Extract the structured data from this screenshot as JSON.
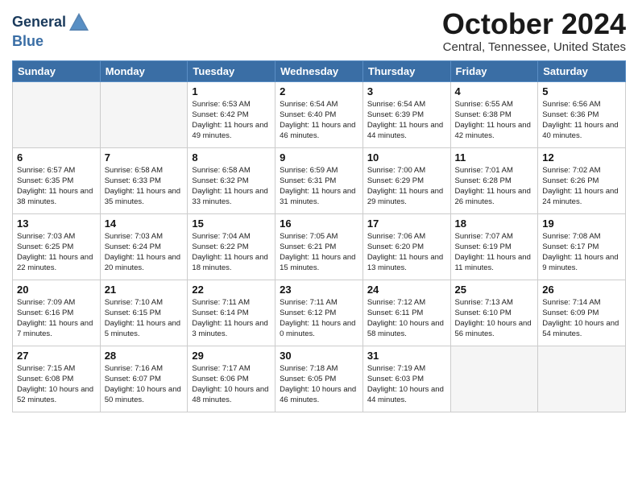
{
  "logo": {
    "line1": "General",
    "line2": "Blue"
  },
  "title": "October 2024",
  "subtitle": "Central, Tennessee, United States",
  "weekdays": [
    "Sunday",
    "Monday",
    "Tuesday",
    "Wednesday",
    "Thursday",
    "Friday",
    "Saturday"
  ],
  "weeks": [
    [
      {
        "day": "",
        "sunrise": "",
        "sunset": "",
        "daylight": ""
      },
      {
        "day": "",
        "sunrise": "",
        "sunset": "",
        "daylight": ""
      },
      {
        "day": "1",
        "sunrise": "Sunrise: 6:53 AM",
        "sunset": "Sunset: 6:42 PM",
        "daylight": "Daylight: 11 hours and 49 minutes."
      },
      {
        "day": "2",
        "sunrise": "Sunrise: 6:54 AM",
        "sunset": "Sunset: 6:40 PM",
        "daylight": "Daylight: 11 hours and 46 minutes."
      },
      {
        "day": "3",
        "sunrise": "Sunrise: 6:54 AM",
        "sunset": "Sunset: 6:39 PM",
        "daylight": "Daylight: 11 hours and 44 minutes."
      },
      {
        "day": "4",
        "sunrise": "Sunrise: 6:55 AM",
        "sunset": "Sunset: 6:38 PM",
        "daylight": "Daylight: 11 hours and 42 minutes."
      },
      {
        "day": "5",
        "sunrise": "Sunrise: 6:56 AM",
        "sunset": "Sunset: 6:36 PM",
        "daylight": "Daylight: 11 hours and 40 minutes."
      }
    ],
    [
      {
        "day": "6",
        "sunrise": "Sunrise: 6:57 AM",
        "sunset": "Sunset: 6:35 PM",
        "daylight": "Daylight: 11 hours and 38 minutes."
      },
      {
        "day": "7",
        "sunrise": "Sunrise: 6:58 AM",
        "sunset": "Sunset: 6:33 PM",
        "daylight": "Daylight: 11 hours and 35 minutes."
      },
      {
        "day": "8",
        "sunrise": "Sunrise: 6:58 AM",
        "sunset": "Sunset: 6:32 PM",
        "daylight": "Daylight: 11 hours and 33 minutes."
      },
      {
        "day": "9",
        "sunrise": "Sunrise: 6:59 AM",
        "sunset": "Sunset: 6:31 PM",
        "daylight": "Daylight: 11 hours and 31 minutes."
      },
      {
        "day": "10",
        "sunrise": "Sunrise: 7:00 AM",
        "sunset": "Sunset: 6:29 PM",
        "daylight": "Daylight: 11 hours and 29 minutes."
      },
      {
        "day": "11",
        "sunrise": "Sunrise: 7:01 AM",
        "sunset": "Sunset: 6:28 PM",
        "daylight": "Daylight: 11 hours and 26 minutes."
      },
      {
        "day": "12",
        "sunrise": "Sunrise: 7:02 AM",
        "sunset": "Sunset: 6:26 PM",
        "daylight": "Daylight: 11 hours and 24 minutes."
      }
    ],
    [
      {
        "day": "13",
        "sunrise": "Sunrise: 7:03 AM",
        "sunset": "Sunset: 6:25 PM",
        "daylight": "Daylight: 11 hours and 22 minutes."
      },
      {
        "day": "14",
        "sunrise": "Sunrise: 7:03 AM",
        "sunset": "Sunset: 6:24 PM",
        "daylight": "Daylight: 11 hours and 20 minutes."
      },
      {
        "day": "15",
        "sunrise": "Sunrise: 7:04 AM",
        "sunset": "Sunset: 6:22 PM",
        "daylight": "Daylight: 11 hours and 18 minutes."
      },
      {
        "day": "16",
        "sunrise": "Sunrise: 7:05 AM",
        "sunset": "Sunset: 6:21 PM",
        "daylight": "Daylight: 11 hours and 15 minutes."
      },
      {
        "day": "17",
        "sunrise": "Sunrise: 7:06 AM",
        "sunset": "Sunset: 6:20 PM",
        "daylight": "Daylight: 11 hours and 13 minutes."
      },
      {
        "day": "18",
        "sunrise": "Sunrise: 7:07 AM",
        "sunset": "Sunset: 6:19 PM",
        "daylight": "Daylight: 11 hours and 11 minutes."
      },
      {
        "day": "19",
        "sunrise": "Sunrise: 7:08 AM",
        "sunset": "Sunset: 6:17 PM",
        "daylight": "Daylight: 11 hours and 9 minutes."
      }
    ],
    [
      {
        "day": "20",
        "sunrise": "Sunrise: 7:09 AM",
        "sunset": "Sunset: 6:16 PM",
        "daylight": "Daylight: 11 hours and 7 minutes."
      },
      {
        "day": "21",
        "sunrise": "Sunrise: 7:10 AM",
        "sunset": "Sunset: 6:15 PM",
        "daylight": "Daylight: 11 hours and 5 minutes."
      },
      {
        "day": "22",
        "sunrise": "Sunrise: 7:11 AM",
        "sunset": "Sunset: 6:14 PM",
        "daylight": "Daylight: 11 hours and 3 minutes."
      },
      {
        "day": "23",
        "sunrise": "Sunrise: 7:11 AM",
        "sunset": "Sunset: 6:12 PM",
        "daylight": "Daylight: 11 hours and 0 minutes."
      },
      {
        "day": "24",
        "sunrise": "Sunrise: 7:12 AM",
        "sunset": "Sunset: 6:11 PM",
        "daylight": "Daylight: 10 hours and 58 minutes."
      },
      {
        "day": "25",
        "sunrise": "Sunrise: 7:13 AM",
        "sunset": "Sunset: 6:10 PM",
        "daylight": "Daylight: 10 hours and 56 minutes."
      },
      {
        "day": "26",
        "sunrise": "Sunrise: 7:14 AM",
        "sunset": "Sunset: 6:09 PM",
        "daylight": "Daylight: 10 hours and 54 minutes."
      }
    ],
    [
      {
        "day": "27",
        "sunrise": "Sunrise: 7:15 AM",
        "sunset": "Sunset: 6:08 PM",
        "daylight": "Daylight: 10 hours and 52 minutes."
      },
      {
        "day": "28",
        "sunrise": "Sunrise: 7:16 AM",
        "sunset": "Sunset: 6:07 PM",
        "daylight": "Daylight: 10 hours and 50 minutes."
      },
      {
        "day": "29",
        "sunrise": "Sunrise: 7:17 AM",
        "sunset": "Sunset: 6:06 PM",
        "daylight": "Daylight: 10 hours and 48 minutes."
      },
      {
        "day": "30",
        "sunrise": "Sunrise: 7:18 AM",
        "sunset": "Sunset: 6:05 PM",
        "daylight": "Daylight: 10 hours and 46 minutes."
      },
      {
        "day": "31",
        "sunrise": "Sunrise: 7:19 AM",
        "sunset": "Sunset: 6:03 PM",
        "daylight": "Daylight: 10 hours and 44 minutes."
      },
      {
        "day": "",
        "sunrise": "",
        "sunset": "",
        "daylight": ""
      },
      {
        "day": "",
        "sunrise": "",
        "sunset": "",
        "daylight": ""
      }
    ]
  ]
}
